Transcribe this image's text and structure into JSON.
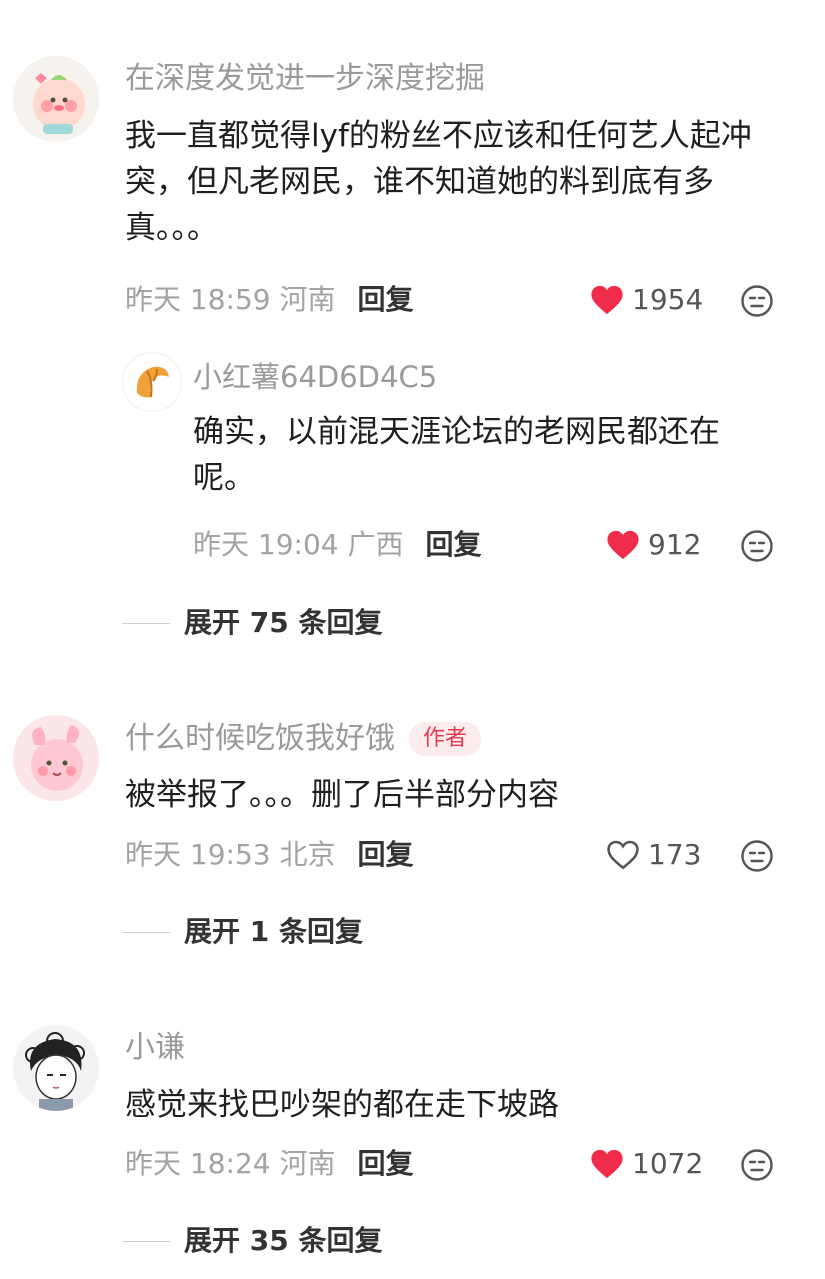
{
  "comments": [
    {
      "username": "在深度发觉进一步深度挖掘",
      "text": "我一直都觉得lyf的粉丝不应该和任何艺人起冲突，但凡老网民，谁不知道她的料到底有多真。。。",
      "time": "昨天 18:59",
      "location": "河南",
      "reply_label": "回复",
      "likes": "1954",
      "liked": true,
      "avatar": "peach-avatar",
      "sub_reply": {
        "username": "小红薯64D6D4C5",
        "text": "确实，以前混天涯论坛的老网民都还在呢。",
        "time": "昨天 19:04",
        "location": "广西",
        "reply_label": "回复",
        "likes": "912",
        "liked": true,
        "avatar": "croissant-avatar"
      },
      "expand_label": "展开 75 条回复"
    },
    {
      "username": "什么时候吃饭我好饿",
      "badge": "作者",
      "text": "被举报了。。。删了后半部分内容",
      "time": "昨天 19:53",
      "location": "北京",
      "reply_label": "回复",
      "likes": "173",
      "liked": false,
      "avatar": "pink-bunny-avatar",
      "expand_label": "展开 1 条回复"
    },
    {
      "username": "小谦",
      "text": "感觉来找巴吵架的都在走下坡路",
      "time": "昨天 18:24",
      "location": "河南",
      "reply_label": "回复",
      "likes": "1072",
      "liked": true,
      "avatar": "curly-hair-girl-avatar",
      "expand_label": "展开 35 条回复"
    }
  ],
  "colors": {
    "like_red": "#ef2d4a",
    "meta_gray": "#a3a3a3",
    "badge_bg": "#fdecee",
    "badge_text": "#e33a4f"
  }
}
